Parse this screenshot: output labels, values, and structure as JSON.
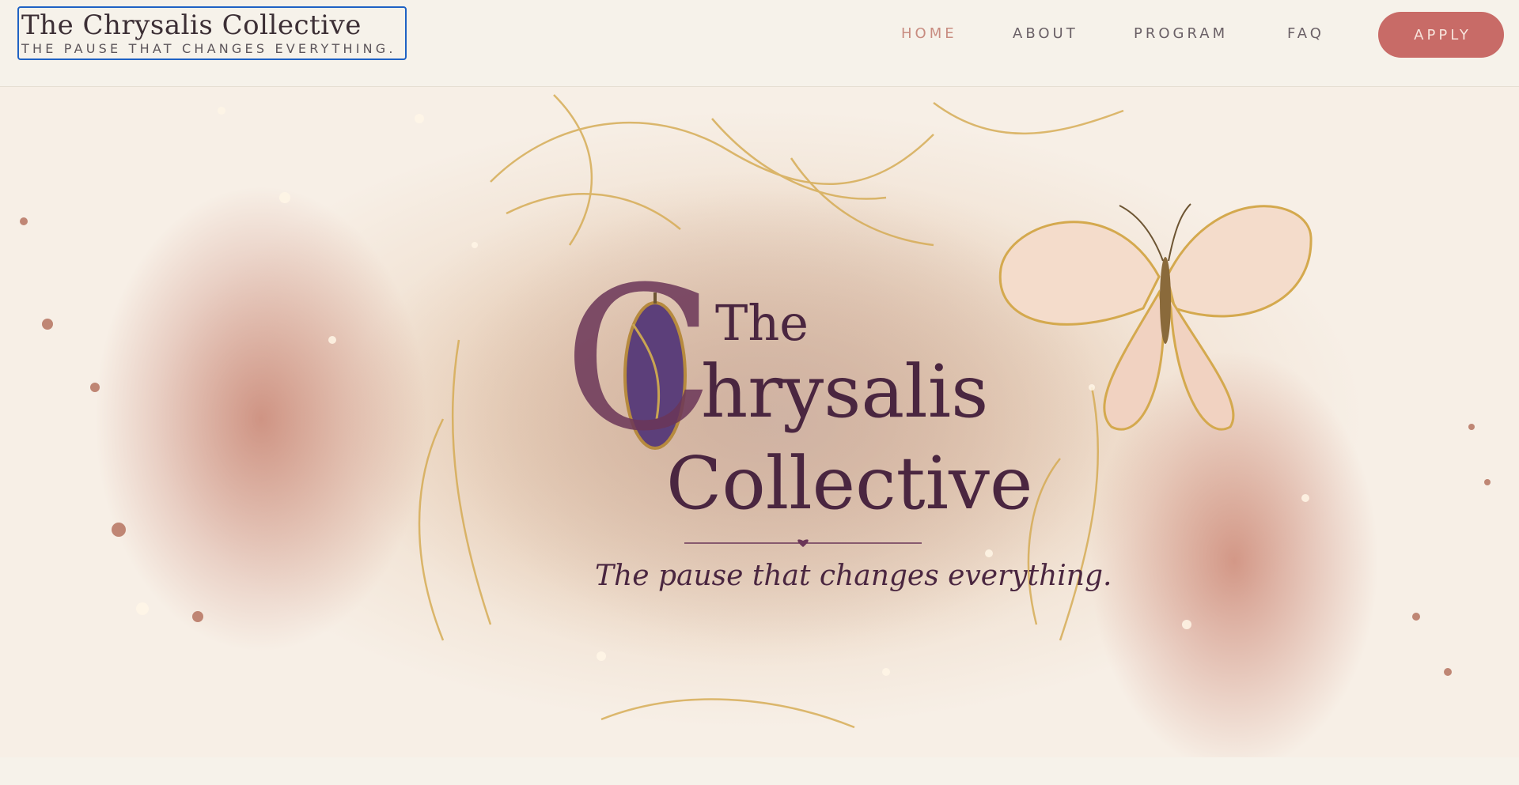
{
  "brand": {
    "title": "The Chrysalis Collective",
    "subtitle": "THE PAUSE THAT CHANGES EVERYTHING."
  },
  "nav": {
    "items": [
      {
        "label": "HOME",
        "active": true
      },
      {
        "label": "ABOUT",
        "active": false
      },
      {
        "label": "PROGRAM",
        "active": false
      },
      {
        "label": "FAQ",
        "active": false
      }
    ],
    "cta": "APPLY"
  },
  "hero": {
    "logo_the": "The",
    "logo_c": "C",
    "logo_hrysalis": "hrysalis",
    "logo_collective": "Collective",
    "tagline": "The pause that changes everything."
  },
  "colors": {
    "accent": "#c86b67",
    "nav_active": "#c88c80",
    "brand_text": "#3c2f35",
    "logo_purple": "#4a2640",
    "gold": "#d4a94e"
  }
}
